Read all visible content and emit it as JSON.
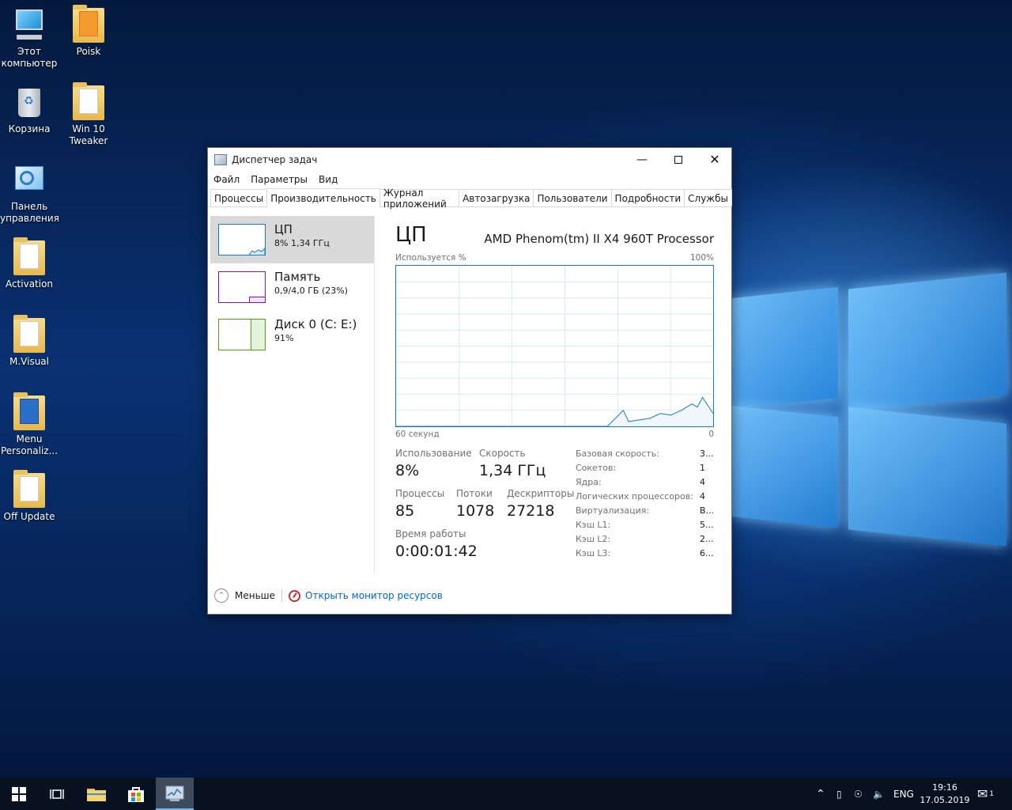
{
  "desktop": {
    "icons": [
      {
        "label": "Этот компьютер",
        "type": "pc"
      },
      {
        "label": "Poisk",
        "type": "folder"
      },
      {
        "label": "Корзина",
        "type": "bin"
      },
      {
        "label": "Win 10 Tweaker",
        "type": "folder"
      },
      {
        "label": "Панель управления",
        "type": "control-panel"
      },
      {
        "label": "Activation",
        "type": "folder"
      },
      {
        "label": "M.Visual",
        "type": "folder"
      },
      {
        "label": "Menu Personaliz...",
        "type": "folder"
      },
      {
        "label": "Off Update",
        "type": "folder"
      }
    ]
  },
  "window": {
    "title": "Диспетчер задач",
    "menu": [
      "Файл",
      "Параметры",
      "Вид"
    ],
    "tabs": [
      "Процессы",
      "Производительность",
      "Журнал приложений",
      "Автозагрузка",
      "Пользователи",
      "Подробности",
      "Службы"
    ],
    "active_tab": "Производительность",
    "sidebar": [
      {
        "name": "ЦП",
        "sub": "8% 1,34 ГГц",
        "color": "#117dbb"
      },
      {
        "name": "Память",
        "sub": "0,9/4,0 ГБ (23%)",
        "color": "#8b12ae"
      },
      {
        "name": "Диск 0 (C: E:)",
        "sub": "91%",
        "color": "#4da60c"
      }
    ],
    "main": {
      "title": "ЦП",
      "model": "AMD Phenom(tm) II X4 960T Processor",
      "graph_label_left": "Используется %",
      "graph_label_right": "100%",
      "axis_left": "60 секунд",
      "axis_right": "0",
      "stats": {
        "usage_label": "Использование",
        "usage_value": "8%",
        "speed_label": "Скорость",
        "speed_value": "1,34 ГГц",
        "processes_label": "Процессы",
        "processes_value": "85",
        "threads_label": "Потоки",
        "threads_value": "1078",
        "handles_label": "Дескрипторы",
        "handles_value": "27218",
        "uptime_label": "Время работы",
        "uptime_value": "0:00:01:42"
      },
      "details": [
        {
          "k": "Базовая скорость:",
          "v": "3..."
        },
        {
          "k": "Сокетов:",
          "v": "1"
        },
        {
          "k": "Ядра:",
          "v": "4"
        },
        {
          "k": "Логических процессоров:",
          "v": "4"
        },
        {
          "k": "Виртуализация:",
          "v": "В..."
        },
        {
          "k": "Кэш L1:",
          "v": "5..."
        },
        {
          "k": "Кэш L2:",
          "v": "2..."
        },
        {
          "k": "Кэш L3:",
          "v": "6..."
        }
      ]
    },
    "footer": {
      "less_label": "Меньше",
      "monitor_link": "Открыть монитор ресурсов"
    }
  },
  "chart_data": {
    "type": "area",
    "xlabel": "60 секунд",
    "ylabel": "Используется %",
    "ylim": [
      0,
      100
    ],
    "xlim": [
      60,
      0
    ],
    "series": [
      {
        "values_x": [
          60,
          20,
          17,
          16,
          14,
          12,
          10,
          8,
          6,
          4,
          3,
          2,
          0
        ],
        "values_y": [
          0,
          0,
          10,
          3,
          4,
          5,
          8,
          7,
          10,
          14,
          12,
          18,
          8
        ]
      }
    ]
  },
  "taskbar": {
    "lang": "ENG",
    "time": "19:16",
    "date": "17.05.2019",
    "notification_count": "1"
  }
}
